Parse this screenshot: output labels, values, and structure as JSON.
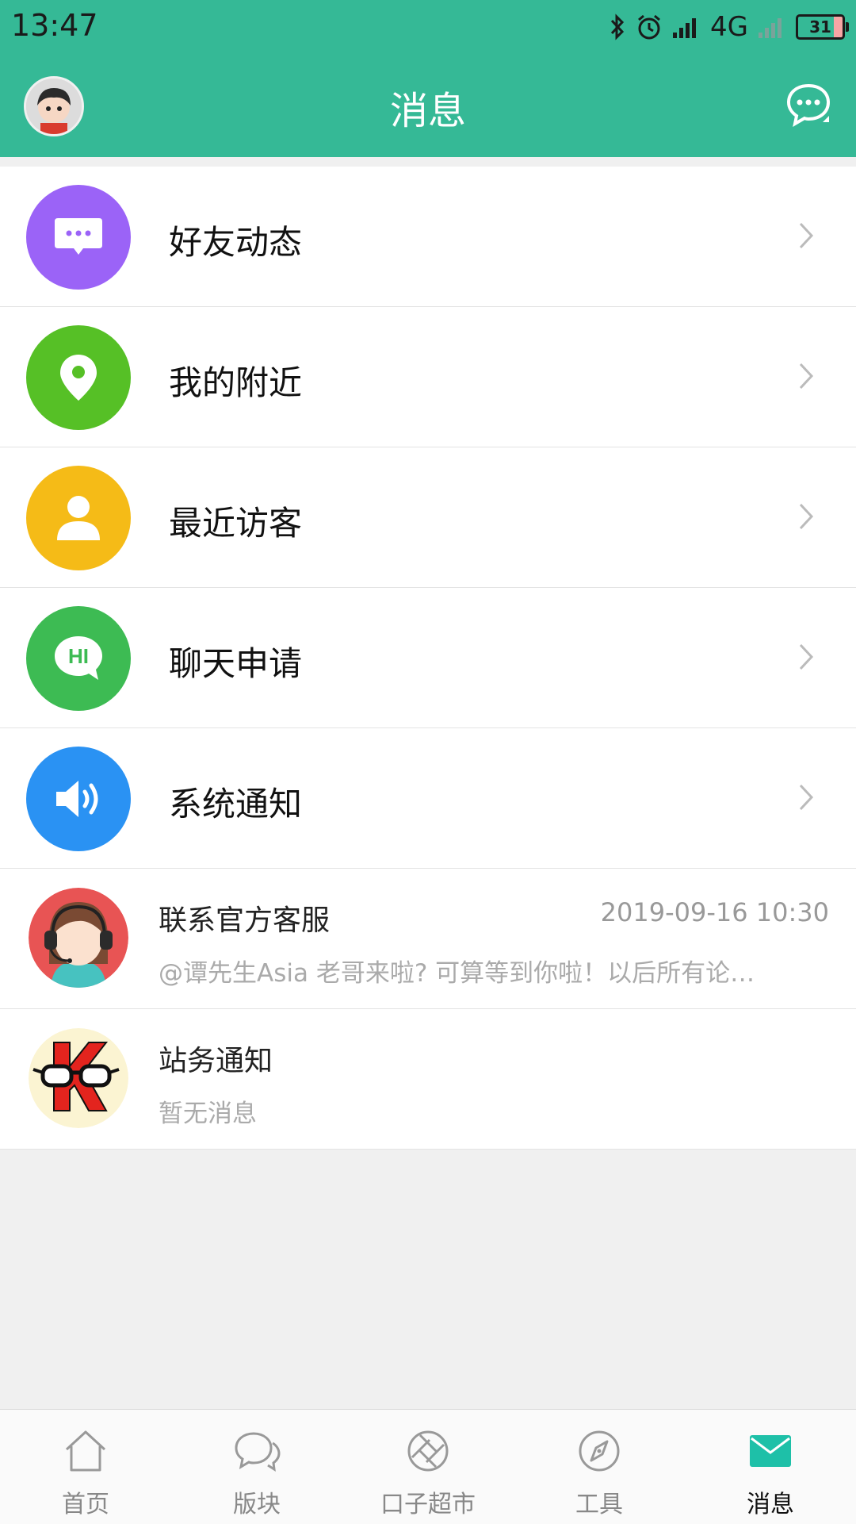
{
  "status_bar": {
    "time": "13:47",
    "network": "4G",
    "battery": "31"
  },
  "header": {
    "title": "消息"
  },
  "menu_items": [
    {
      "label": "好友动态",
      "color": "#9b63f7",
      "icon": "comment-dots-icon"
    },
    {
      "label": "我的附近",
      "color": "#56c026",
      "icon": "location-pin-icon"
    },
    {
      "label": "最近访客",
      "color": "#f5bb17",
      "icon": "user-icon"
    },
    {
      "label": "聊天申请",
      "color": "#3dbb53",
      "icon": "hi-bubble-icon",
      "icon_text": "HI"
    },
    {
      "label": "系统通知",
      "color": "#2a92f3",
      "icon": "speaker-icon"
    }
  ],
  "messages": [
    {
      "name": "联系官方客服",
      "time": "2019-09-16 10:30",
      "preview": "@谭先生Asia 老哥来啦? 可算等到你啦！以后所有论坛、活动、商家问题都可以找我哦"
    },
    {
      "name": "站务通知",
      "time": "",
      "preview": "暂无消息"
    }
  ],
  "tabs": [
    {
      "label": "首页",
      "icon": "home-icon",
      "active": false
    },
    {
      "label": "版块",
      "icon": "chat-bubbles-icon",
      "active": false
    },
    {
      "label": "口子超市",
      "icon": "aperture-icon",
      "active": false
    },
    {
      "label": "工具",
      "icon": "compass-icon",
      "active": false
    },
    {
      "label": "消息",
      "icon": "envelope-icon",
      "active": true
    }
  ],
  "colors": {
    "brand": "#35b996",
    "active_tab": "#1ec0a8"
  }
}
